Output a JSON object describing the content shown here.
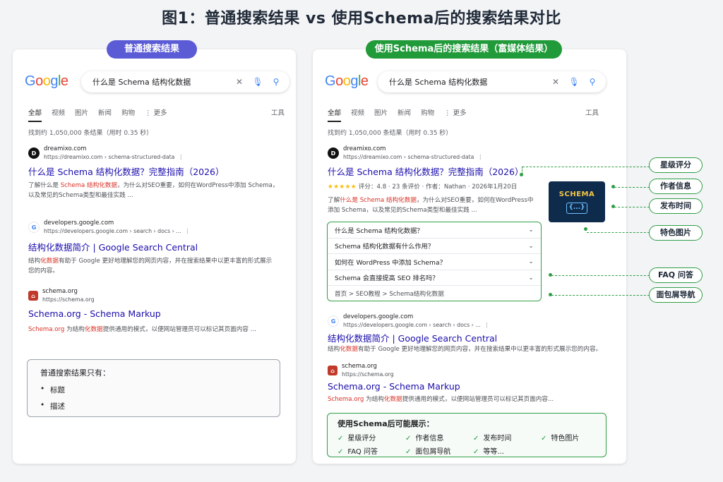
{
  "title": "图1：普通搜索结果 vs 使用Schema后的搜索结果对比",
  "left": {
    "badge": "普通搜索结果",
    "logo_letters": [
      "G",
      "o",
      "o",
      "g",
      "l",
      "e"
    ],
    "query": "什么是 Schema 结构化数据",
    "tabs": [
      "全部",
      "视频",
      "图片",
      "新闻",
      "购物",
      "⋮ 更多"
    ],
    "tools": "工具",
    "stats": "找到约 1,050,000 条结果（用时 0.35 秒）",
    "results": [
      {
        "site": "dreamixo.com",
        "url": "https://dreamixo.com › schema-structured-data",
        "title": "什么是 Schema 结构化数据？完整指南（2026）",
        "desc_parts": [
          "了解什么是 ",
          "Schema 结构化数据",
          "，为什么对SEO重要，如何在WordPress中添加 Schema，以及常见的Schema类型和最佳实践 ..."
        ]
      },
      {
        "site": "developers.google.com",
        "url": "https://developers.google.com › search › docs › ...",
        "title": "结构化数据简介 | Google Search Central",
        "desc_parts": [
          "结构",
          "化数据",
          "有助于 Google 更好地理解您的网页内容，并在搜索结果中以更丰富的形式展示您的内容。"
        ]
      },
      {
        "site": "schema.org",
        "url": "https://schema.org",
        "title": "Schema.org - Schema Markup",
        "desc_parts": [
          "Schema.org",
          " 为结构",
          "化数据",
          "提供通用的模式，以便网站管理员可以标记其页面内容 ..."
        ]
      }
    ],
    "note": {
      "title": "普通搜索结果只有：",
      "items": [
        "标题",
        "描述"
      ]
    }
  },
  "right": {
    "badge": "使用Schema后的搜索结果（富媒体结果）",
    "query": "什么是 Schema 结构化数据",
    "tabs": [
      "全部",
      "视频",
      "图片",
      "新闻",
      "购物",
      "⋮ 更多"
    ],
    "tools": "工具",
    "stats": "找到约 1,050,000 条结果（用时 0.35 秒）",
    "main_result": {
      "site": "dreamixo.com",
      "url": "https://dreamixo.com › schema-structured-data",
      "title": "什么是 Schema 结构化数据？完整指南（2026）",
      "stars": "★★★★★",
      "rating_meta": "评分：4.8 · 23 条评价 · 作者：Nathan · 2026年1月20日",
      "desc_parts": [
        "了解",
        "什么是 Schema 结构化数据",
        "，为什么对SEO重要，如何在WordPress中添加 Schema，以及常见的Schema类型和最佳实践 ..."
      ],
      "image_label": "SCHEMA",
      "image_code": "{...}",
      "faq": [
        "什么是 Schema 结构化数据？",
        "Schema 结构化数据有什么作用？",
        "如何在 WordPress 中添加 Schema？",
        "Schema 会直接提高 SEO 排名吗？"
      ],
      "breadcrumb": "首页 > SEO教程 > Schema结构化数据"
    },
    "results": [
      {
        "site": "developers.google.com",
        "url": "https://developers.google.com › search › docs › ...",
        "title": "结构化数据简介 | Google Search Central",
        "desc_parts": [
          "结构",
          "化数据",
          "有助于 Google 更好地理解您的网页内容，并在搜索结果中以更丰富的形式展示您的内容。"
        ]
      },
      {
        "site": "schema.org",
        "url": "https://schema.org",
        "title": "Schema.org - Schema Markup",
        "desc_parts": [
          "Schema.org",
          " 为结构",
          "化数据",
          "提供通用的模式，以便网站管理员可以标记其页面内容..."
        ]
      }
    ],
    "schema_box": {
      "title": "使用Schema后可能展示：",
      "items": [
        "星级评分",
        "作者信息",
        "发布时间",
        "特色图片",
        "FAQ 问答",
        "面包屑导航",
        "等等..."
      ]
    }
  },
  "callouts": [
    "星级评分",
    "作者信息",
    "发布时间",
    "特色图片",
    "FAQ 问答",
    "面包屑导航"
  ],
  "colors": {
    "accent_green": "#219a3a",
    "accent_blue": "#5b5bd6",
    "link": "#1a0dab",
    "highlight": "#d93025",
    "stars": "#fbbc05"
  }
}
